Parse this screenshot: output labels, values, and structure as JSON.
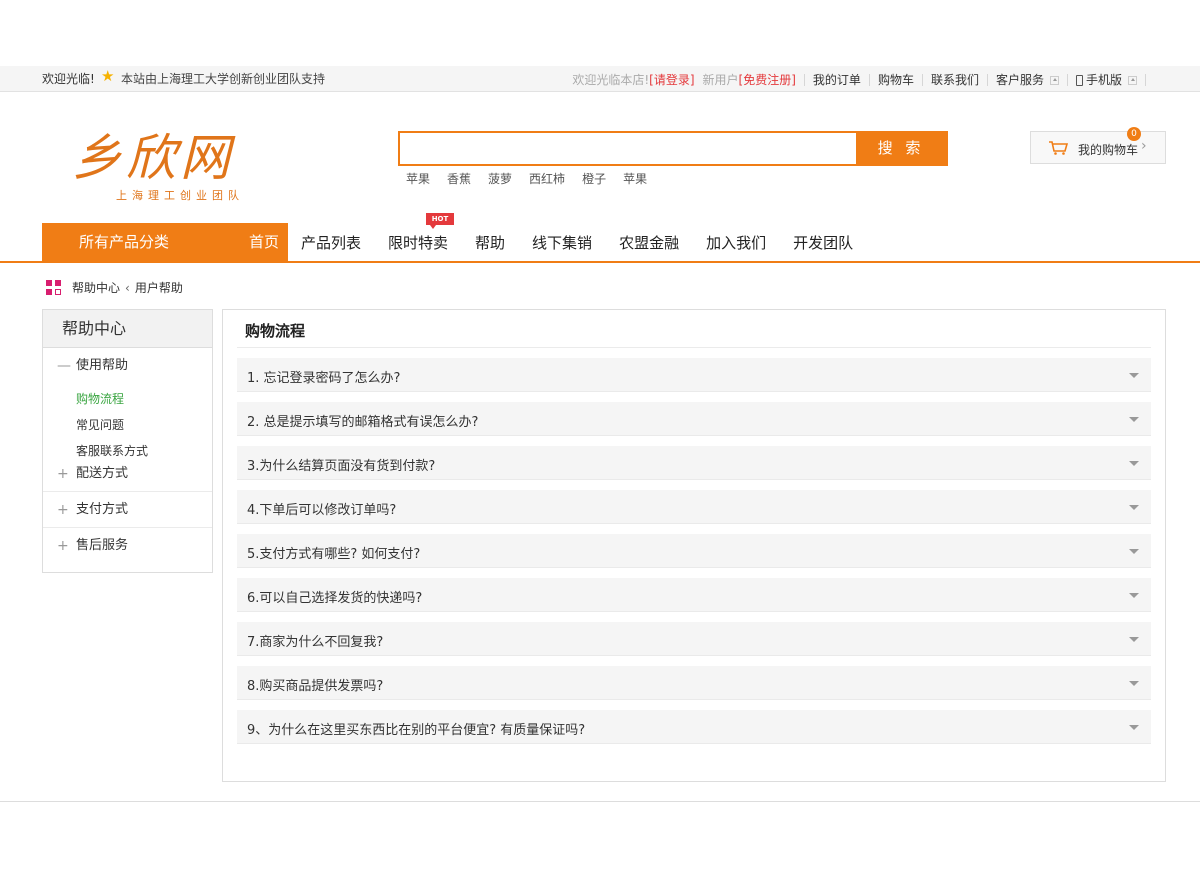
{
  "topbar": {
    "welcome": "欢迎光临!",
    "support": "本站由上海理工大学创新创业团队支持",
    "store_welcome": "欢迎光临本店!",
    "login": "[请登录]",
    "new_user": "新用户",
    "register": "[免费注册]",
    "my_orders": "我的订单",
    "cart": "购物车",
    "contact": "联系我们",
    "service": "客户服务",
    "mobile": "手机版"
  },
  "logo": {
    "main": "乡欣网",
    "sub": "上海理工创业团队"
  },
  "search": {
    "value": "",
    "button": "搜 索",
    "hotwords": [
      "苹果",
      "香蕉",
      "菠萝",
      "西红柿",
      "橙子",
      "苹果"
    ]
  },
  "cart": {
    "label": "我的购物车",
    "count": "0"
  },
  "nav": {
    "all_categories": "所有产品分类",
    "home": "首页",
    "items": [
      "产品列表",
      "限时特卖",
      "帮助",
      "线下集销",
      "农盟金融",
      "加入我们",
      "开发团队"
    ],
    "hot_tag": "HOT"
  },
  "breadcrumb": {
    "root": "帮助中心",
    "current": "用户帮助"
  },
  "sidebar": {
    "title": "帮助中心",
    "groups": [
      {
        "label": "使用帮助",
        "sub": [
          "购物流程",
          "常见问题",
          "客服联系方式"
        ]
      },
      {
        "label": "配送方式"
      },
      {
        "label": "支付方式"
      },
      {
        "label": "售后服务"
      }
    ]
  },
  "panel": {
    "title": "购物流程",
    "questions": [
      "1. 忘记登录密码了怎么办?",
      "2. 总是提示填写的邮箱格式有误怎么办?",
      "3.为什么结算页面没有货到付款?",
      "4.下单后可以修改订单吗?",
      "5.支付方式有哪些? 如何支付?",
      "6.可以自己选择发货的快递吗?",
      "7.商家为什么不回复我?",
      "8.购买商品提供发票吗?",
      "9、为什么在这里买东西比在别的平台便宜? 有质量保证吗?"
    ]
  },
  "colors": {
    "accent": "#f07d15",
    "active_link": "#3aa541",
    "login_red": "#e4393c",
    "crumb_icon": "#d81e6f"
  }
}
